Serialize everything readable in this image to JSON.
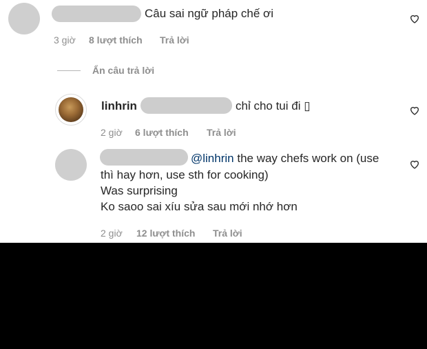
{
  "comments": [
    {
      "text": "Câu sai ngữ pháp chế ơi",
      "time": "3 giờ",
      "likes": "8 lượt thích",
      "reply": "Trả lời"
    }
  ],
  "hide_replies_label": "Ẩn câu trả lời",
  "replies": [
    {
      "username": "linhrin",
      "text": "chỉ cho tui đi ",
      "emoji_placeholder": "▯",
      "time": "2 giờ",
      "likes": "6 lượt thích",
      "reply": "Trả lời"
    },
    {
      "mention": "@linhrin",
      "line1": " the way chefs work on (use",
      "line2": "thì hay hơn, use sth for cooking)",
      "line3": "Was surprising",
      "line4": "Ko saoo sai xíu sửa sau mới nhớ hơn",
      "time": "2 giờ",
      "likes": "12 lượt thích",
      "reply": "Trả lời"
    }
  ],
  "icons": {
    "like": "heart-outline-icon"
  },
  "colors": {
    "mention": "#003569",
    "meta": "#8e8e8e",
    "text": "#262626",
    "blur": "#cdcdcd",
    "background_lower": "#000000"
  }
}
